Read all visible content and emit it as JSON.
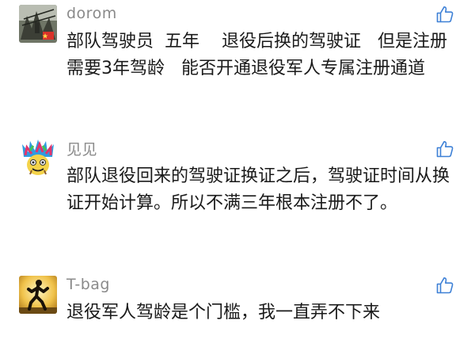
{
  "comments": [
    {
      "username": "dorom",
      "text": "部队驾驶员  五年    退役后换的驾驶证   但是注册需要3年驾龄   能否开通退役军人专属注册通道",
      "avatar": "photo-avatar-flag",
      "like_icon": "thumbs-up-icon"
    },
    {
      "username": "见见",
      "text": "部队退役回来的驾驶证换证之后，驾驶证时间从换证开始计算。所以不满三年根本注册不了。",
      "avatar": "colorful-cartoon-avatar",
      "like_icon": "thumbs-up-icon"
    },
    {
      "username": "T-bag",
      "text": "退役军人驾龄是个门槛，我一直弄不下来",
      "avatar": "running-silhouette-avatar",
      "like_icon": "thumbs-up-icon"
    }
  ],
  "colors": {
    "username": "#8a8a8a",
    "text": "#1a1a1a",
    "like_icon": "#3d80d6"
  }
}
